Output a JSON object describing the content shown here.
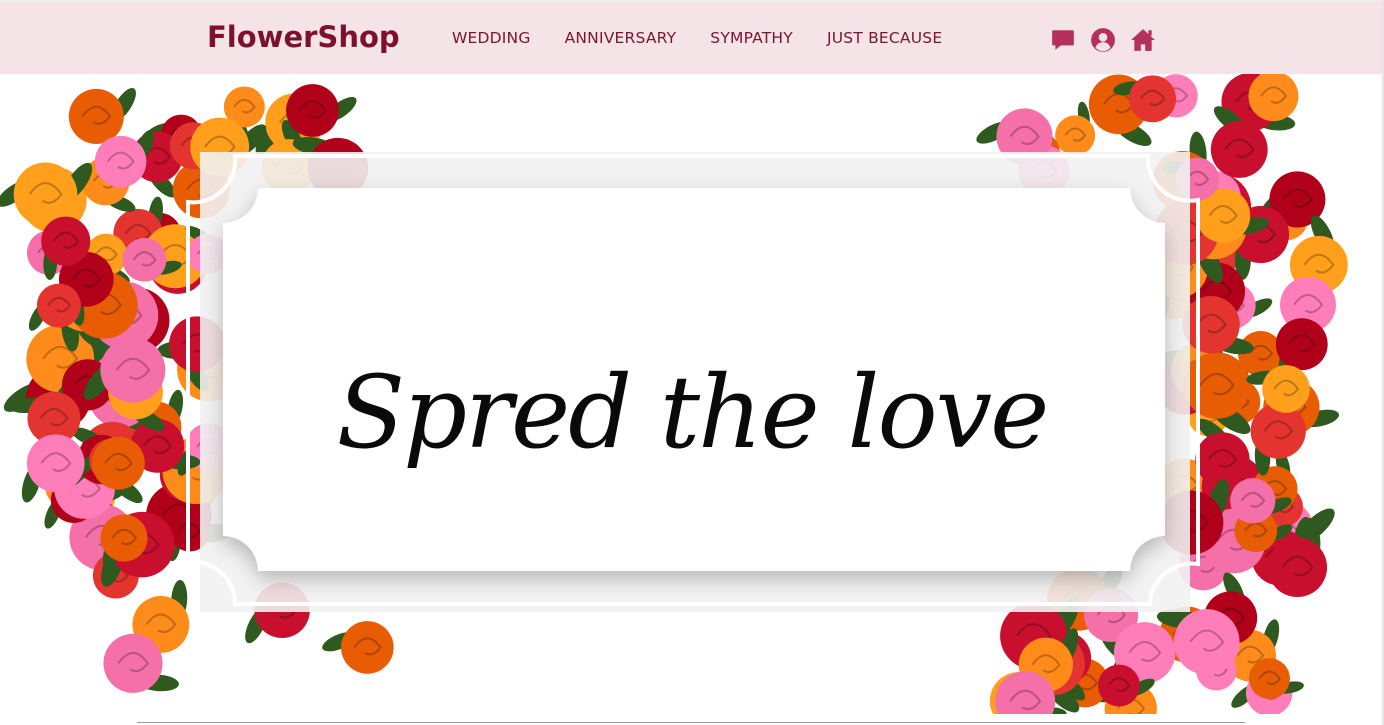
{
  "header": {
    "brand": "FlowerShop",
    "nav": [
      {
        "label": "WEDDING"
      },
      {
        "label": "ANNIVERSARY"
      },
      {
        "label": "SYMPATHY"
      },
      {
        "label": "JUST BECAUSE"
      }
    ],
    "icons": [
      "comment-icon",
      "user-icon",
      "home-icon"
    ]
  },
  "hero": {
    "tagline": "Spred the love"
  },
  "colors": {
    "navbar_bg": "#f5e4e7",
    "brand": "#7d1030",
    "nav_text": "#7a1530",
    "icon": "#b5305a"
  }
}
